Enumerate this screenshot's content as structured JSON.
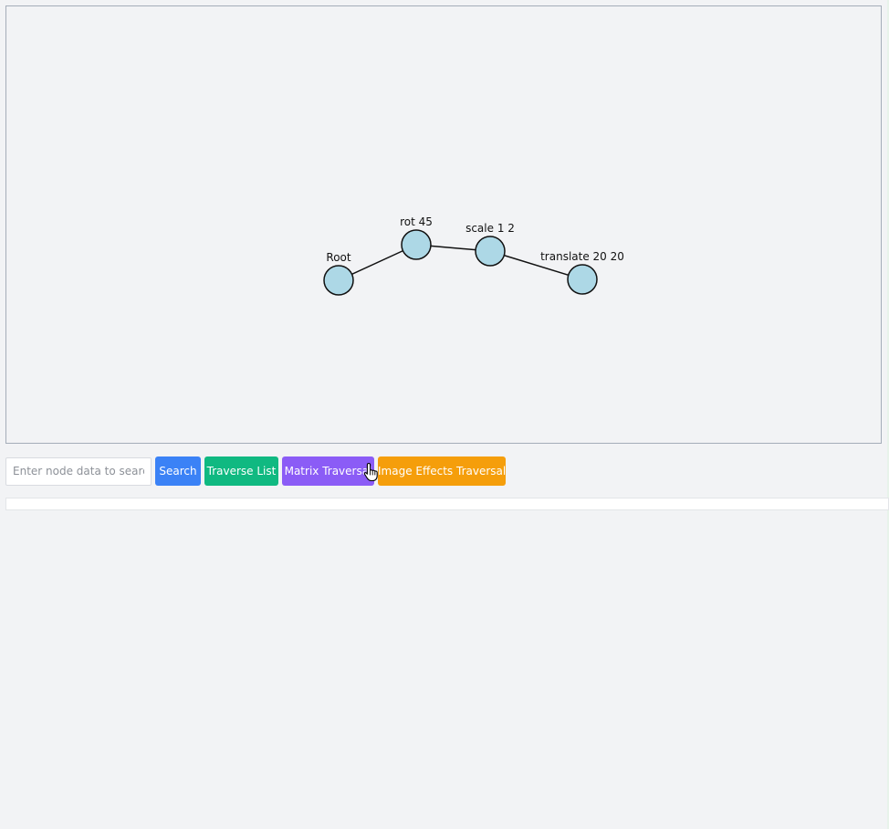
{
  "graph": {
    "nodes": [
      {
        "id": "root",
        "label": "Root"
      },
      {
        "id": "rot",
        "label": "rot 45"
      },
      {
        "id": "scale",
        "label": "scale 1 2"
      },
      {
        "id": "translate",
        "label": "translate 20 20"
      }
    ],
    "edges": [
      [
        "root",
        "rot"
      ],
      [
        "rot",
        "scale"
      ],
      [
        "scale",
        "translate"
      ]
    ],
    "node_fill": "#add8e6",
    "node_stroke": "#111111"
  },
  "controls": {
    "search_placeholder": "Enter node data to search",
    "search_value": "",
    "search_label": "Search",
    "traverse_list_label": "Traverse List",
    "matrix_traversal_label": "Matrix Traversal",
    "image_effects_label": "Image Effects Traversal"
  },
  "output": {
    "text": ""
  },
  "colors": {
    "search": "#3b82f6",
    "traverse_list": "#10b981",
    "matrix_traversal": "#8b5cf6",
    "image_effects": "#f59e0b"
  },
  "cursor": {
    "icon": "hand-pointer-icon"
  }
}
